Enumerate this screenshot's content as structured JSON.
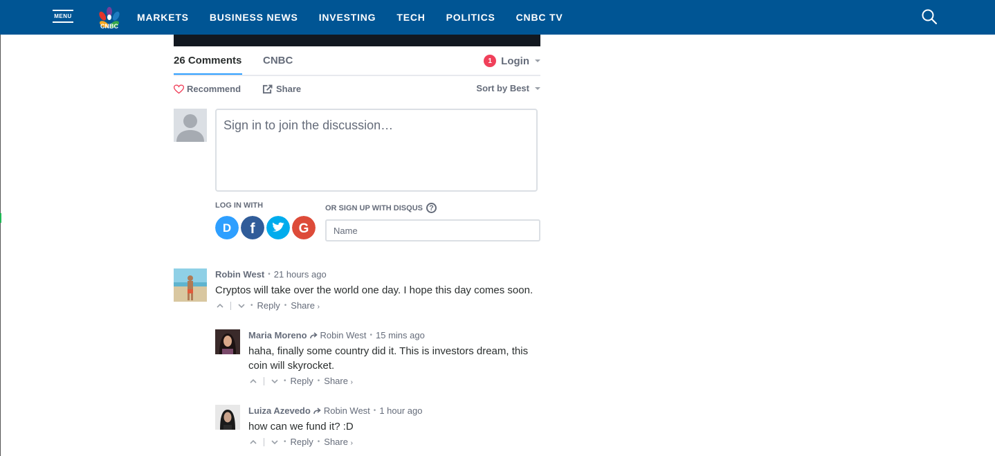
{
  "header": {
    "menu_label": "MENU",
    "nav": [
      "MARKETS",
      "BUSINESS NEWS",
      "INVESTING",
      "TECH",
      "POLITICS",
      "CNBC TV"
    ],
    "bg_color": "#005594"
  },
  "comments_header": {
    "count_label": "26 Comments",
    "site_tab": "CNBC",
    "login_badge": "1",
    "login_label": "Login",
    "recommend_label": "Recommend",
    "share_label": "Share",
    "sort_label": "Sort by Best"
  },
  "composer": {
    "placeholder": "Sign in to join the discussion…",
    "login_with": "LOG IN WITH",
    "signup_label": "OR SIGN UP WITH DISQUS",
    "help": "?",
    "name_placeholder": "Name",
    "social_icons": [
      "disqus-icon",
      "facebook-icon",
      "twitter-icon",
      "google-icon"
    ]
  },
  "comments": [
    {
      "author": "Robin West",
      "parent": "",
      "time": "21 hours ago",
      "text": "Cryptos will take over the world one day. I hope this day comes soon.",
      "reply": "Reply",
      "share": "Share"
    },
    {
      "author": "Maria Moreno",
      "parent": "Robin West",
      "time": "15 mins ago",
      "text": "haha, finally some country did it. This is investors dream, this coin will skyrocket.",
      "reply": "Reply",
      "share": "Share"
    },
    {
      "author": "Luiza Azevedo",
      "parent": "Robin West",
      "time": "1 hour ago",
      "text": "how can we fund it? :D",
      "reply": "Reply",
      "share": "Share"
    }
  ],
  "colors": {
    "accent_blue": "#2e9fff",
    "badge_red": "#f0405a",
    "text_muted": "#656c7a",
    "text_main": "#2a2e2e"
  }
}
